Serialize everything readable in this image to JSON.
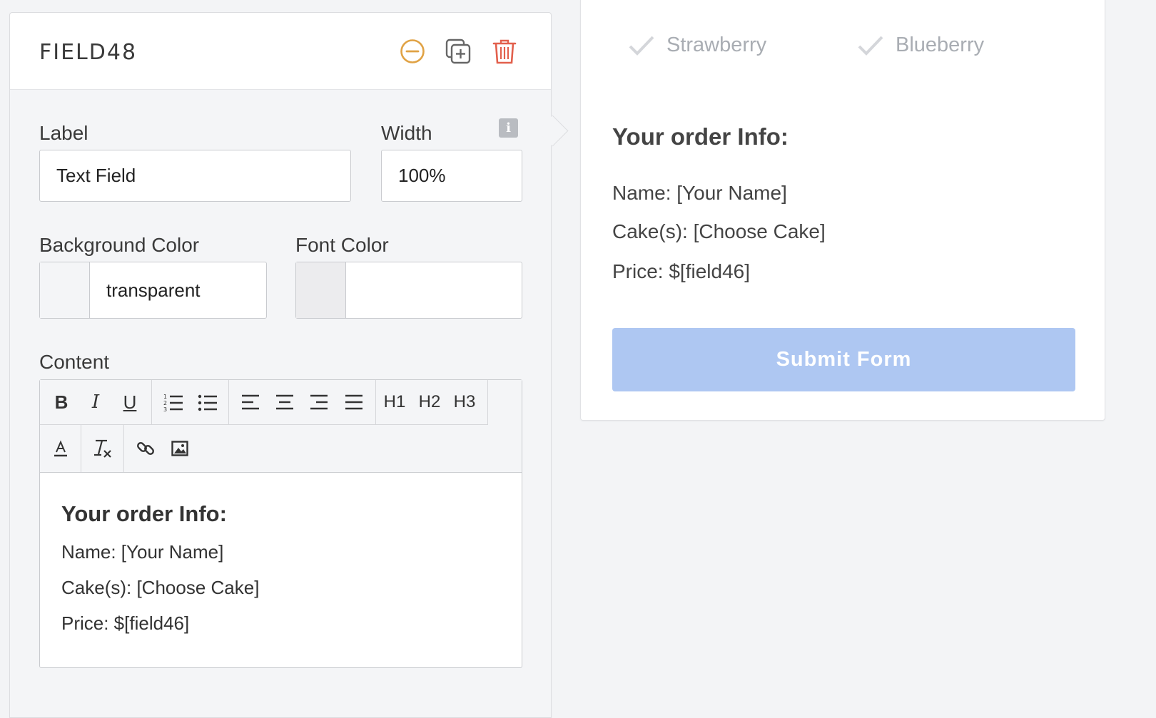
{
  "panel": {
    "title": "FIELD48",
    "label_caption": "Label",
    "label_value": "Text Field",
    "width_caption": "Width",
    "width_value": "100%",
    "info_icon_glyph": "i",
    "bg_color_caption": "Background Color",
    "bg_color_value": "transparent",
    "font_color_caption": "Font Color",
    "font_color_value": "",
    "content_caption": "Content"
  },
  "toolbar": {
    "bold": "B",
    "italic": "I",
    "underline": "U",
    "h1": "H1",
    "h2": "H2",
    "h3": "H3"
  },
  "editor": {
    "heading": "Your order Info:",
    "lines": [
      "Name: [Your Name]",
      "Cake(s): [Choose Cake]",
      "Price: $[field46]"
    ]
  },
  "preview": {
    "options": [
      "Strawberry",
      "Blueberry"
    ],
    "heading": "Your order Info:",
    "lines": [
      "Name: [Your Name]",
      "Cake(s): [Choose Cake]",
      "Price: $[field46]"
    ],
    "submit_label": "Submit Form"
  },
  "colors": {
    "collapse_icon": "#e0a244",
    "delete_icon": "#e2604d",
    "submit_bg": "#aec7f2",
    "check_icon": "#d4d6da"
  },
  "icons": [
    "collapse-icon",
    "duplicate-icon",
    "trash-icon",
    "info-icon",
    "ordered-list-icon",
    "bullet-list-icon",
    "align-left-icon",
    "align-center-icon",
    "align-right-icon",
    "align-justify-icon",
    "font-color-icon",
    "clear-format-icon",
    "link-icon",
    "image-icon",
    "check-icon"
  ]
}
